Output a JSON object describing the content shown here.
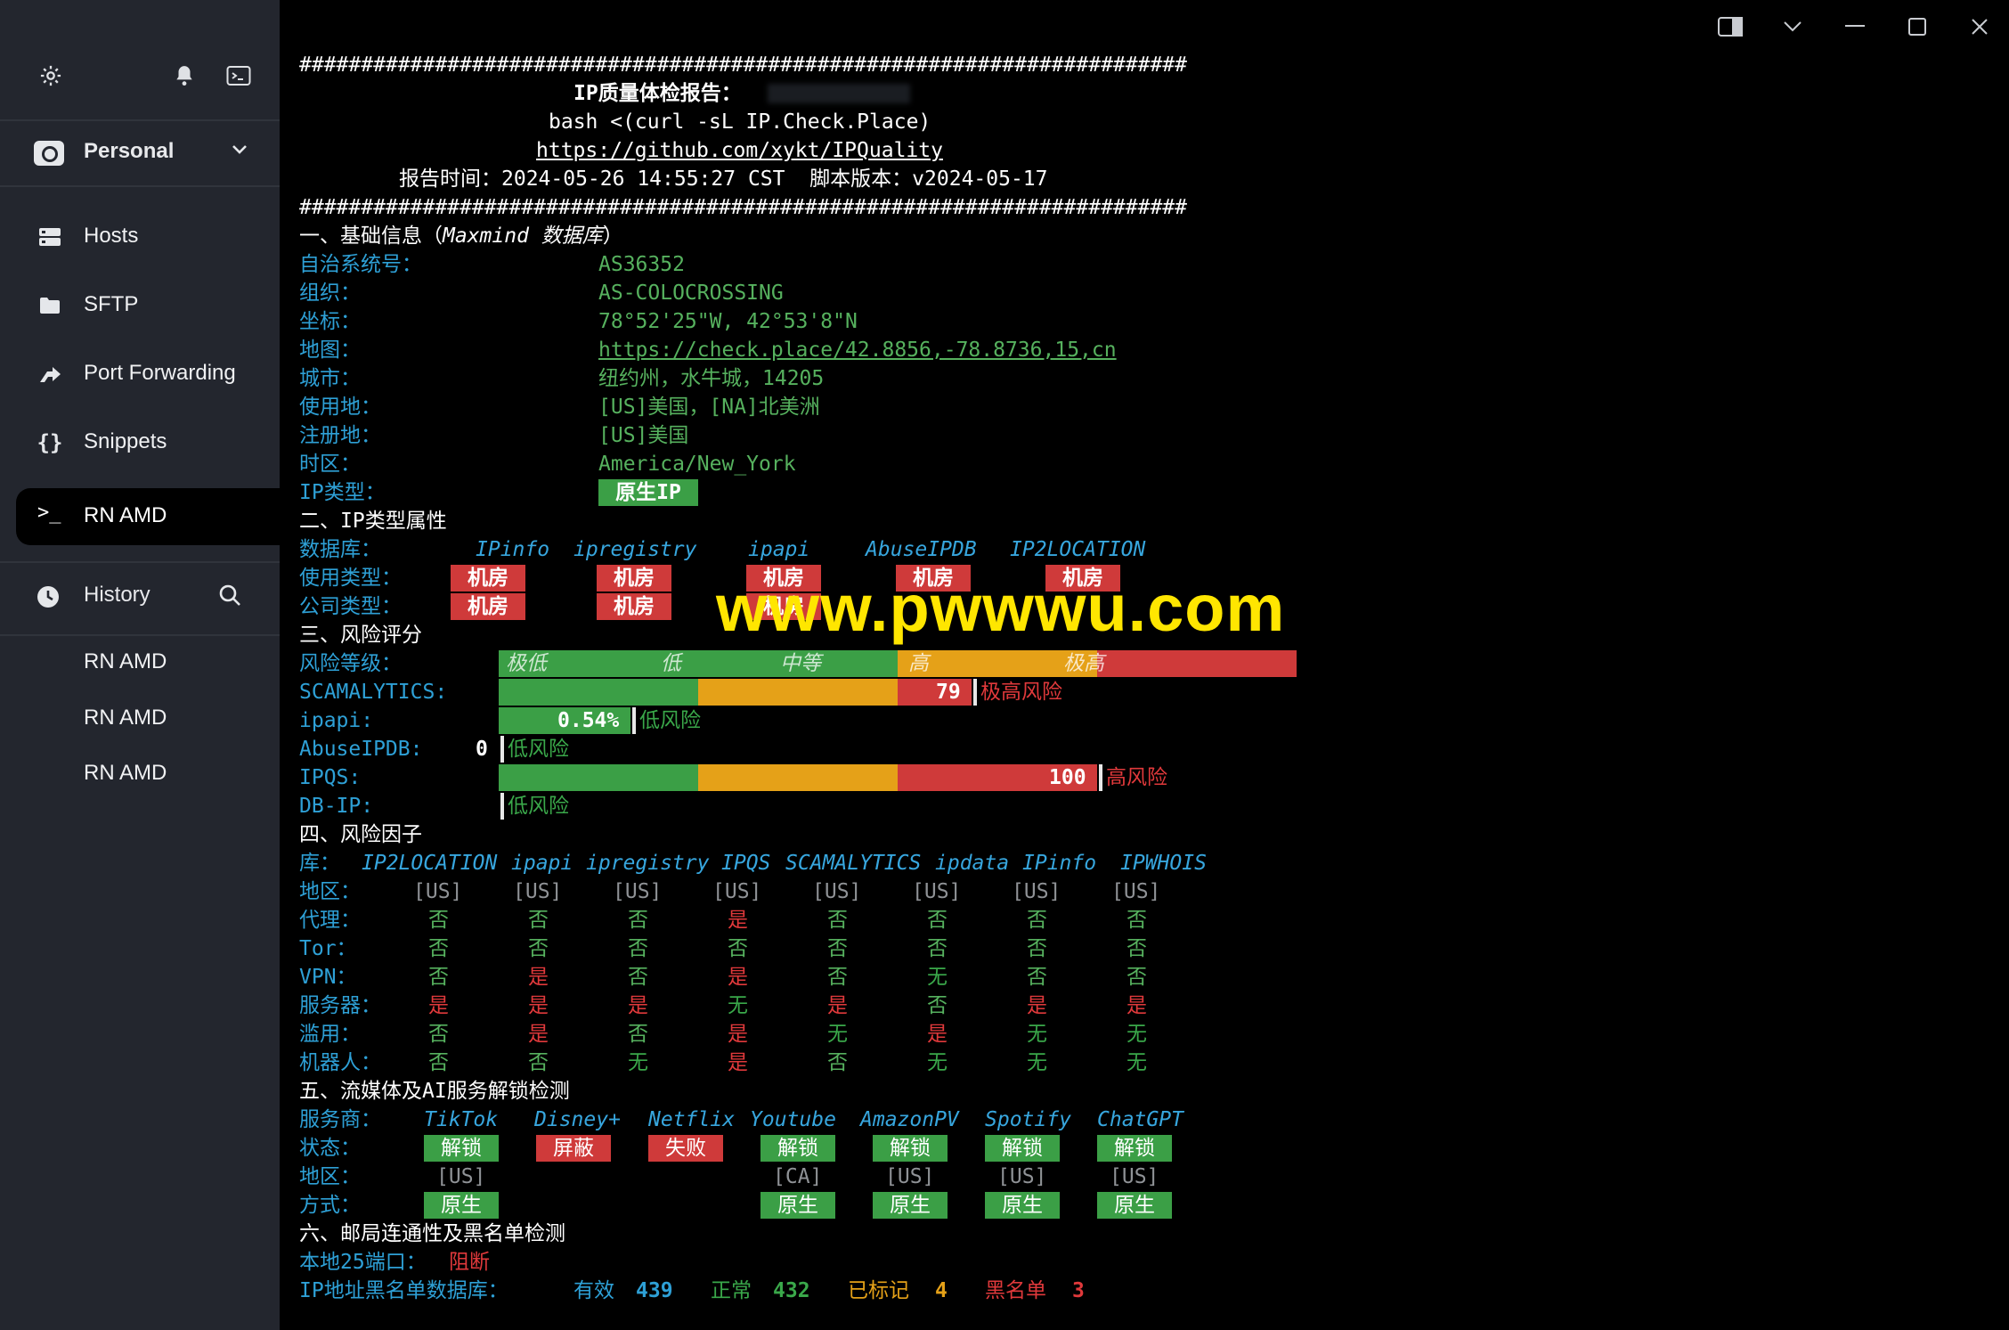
{
  "sidebar": {
    "vault_label": "Personal",
    "nav": [
      {
        "label": "Hosts",
        "icon": "hosts-icon"
      },
      {
        "label": "SFTP",
        "icon": "folder-icon"
      },
      {
        "label": "Port Forwarding",
        "icon": "port-forwarding-icon"
      },
      {
        "label": "Snippets",
        "icon": "braces-icon"
      }
    ],
    "active_tab": "RN AMD",
    "history_label": "History",
    "history_items": [
      "RN AMD",
      "RN AMD",
      "RN AMD"
    ]
  },
  "terminal": {
    "hash_line": "########################################################################",
    "title": "IP质量体检报告：",
    "cmd": "bash <(curl -sL IP.Check.Place)",
    "url": "https://github.com/xykt/IPQuality",
    "time_label": "报告时间：2024-05-26 14:55:27 CST  脚本版本：v2024-05-17",
    "s1": {
      "heading": "一、基础信息（",
      "heading_db": "Maxmind 数据库",
      "heading_end": "）",
      "rows": [
        {
          "k": "自治系统号：",
          "v": "AS36352"
        },
        {
          "k": "组织：",
          "v": "AS-COLOCROSSING"
        },
        {
          "k": "坐标：",
          "v": "78°52'25\"W, 42°53'8\"N"
        },
        {
          "k": "地图：",
          "v": "https://check.place/42.8856,-78.8736,15,cn"
        },
        {
          "k": "城市：",
          "v": "纽约州，水牛城，14205"
        },
        {
          "k": "使用地：",
          "v": "[US]美国，[NA]北美洲"
        },
        {
          "k": "注册地：",
          "v": "[US]美国"
        },
        {
          "k": "时区：",
          "v": "America/New_York"
        }
      ],
      "iptype_label": "IP类型：",
      "iptype_badge": "原生IP"
    },
    "s2": {
      "heading": "二、IP类型属性",
      "db_label": "数据库：",
      "dbs": [
        "IPinfo",
        "ipregistry",
        "ipapi",
        "AbuseIPDB",
        "IP2LOCATION"
      ],
      "use_label": "使用类型：",
      "use_vals": [
        "机房",
        "机房",
        "机房",
        "机房",
        "机房"
      ],
      "corp_label": "公司类型：",
      "corp_vals": [
        "机房",
        "机房",
        "机房"
      ]
    },
    "s3": {
      "heading": "三、风险评分",
      "level_label": "风险等级：",
      "levels": [
        "极低",
        "低",
        "中等",
        "高",
        "极高"
      ],
      "rows": [
        {
          "k": "SCAMALYTICS:",
          "score": "79",
          "text": "极高风险",
          "fraction": 0.79
        },
        {
          "k": "ipapi:",
          "score": "0.54%",
          "text": "低风险",
          "fraction": 0.22
        },
        {
          "k": "AbuseIPDB:",
          "score": "0",
          "text": "低风险",
          "fraction": 0.0
        },
        {
          "k": "IPQS:",
          "score": "100",
          "text": "高风险",
          "fraction": 1.0
        },
        {
          "k": "DB-IP:",
          "score": "",
          "text": "低风险",
          "fraction": 0.0
        }
      ]
    },
    "s4": {
      "heading": "四、风险因子",
      "lib_label": "库：",
      "libs": [
        "IP2LOCATION",
        "ipapi",
        "ipregistry",
        "IPQS",
        "SCAMALYTICS",
        "ipdata",
        "IPinfo",
        "IPWHOIS"
      ],
      "rows": [
        {
          "k": "地区：",
          "vals": [
            "[US]",
            "[US]",
            "[US]",
            "[US]",
            "[US]",
            "[US]",
            "[US]",
            "[US]"
          ]
        },
        {
          "k": "代理：",
          "vals": [
            "否",
            "否",
            "否",
            "是",
            "否",
            "否",
            "否",
            "否"
          ]
        },
        {
          "k": "Tor：",
          "vals": [
            "否",
            "否",
            "否",
            "否",
            "否",
            "否",
            "否",
            "否"
          ]
        },
        {
          "k": "VPN：",
          "vals": [
            "否",
            "是",
            "否",
            "是",
            "否",
            "无",
            "否",
            "否"
          ]
        },
        {
          "k": "服务器：",
          "vals": [
            "是",
            "是",
            "是",
            "无",
            "是",
            "否",
            "是",
            "是"
          ]
        },
        {
          "k": "滥用：",
          "vals": [
            "否",
            "是",
            "否",
            "是",
            "无",
            "是",
            "无",
            "无"
          ]
        },
        {
          "k": "机器人：",
          "vals": [
            "否",
            "否",
            "无",
            "是",
            "否",
            "无",
            "无",
            "无"
          ]
        }
      ]
    },
    "s5": {
      "heading": "五、流媒体及AI服务解锁检测",
      "svc_label": "服务商：",
      "services": [
        "TikTok",
        "Disney+",
        "Netflix",
        "Youtube",
        "AmazonPV",
        "Spotify",
        "ChatGPT"
      ],
      "status_label": "状态：",
      "status": [
        "解锁",
        "屏蔽",
        "失败",
        "解锁",
        "解锁",
        "解锁",
        "解锁"
      ],
      "region_label": "地区：",
      "regions": [
        "[US]",
        "",
        "",
        "[CA]",
        "[US]",
        "[US]",
        "[US]"
      ],
      "method_label": "方式：",
      "methods": [
        "原生",
        "",
        "",
        "原生",
        "原生",
        "原生",
        "原生"
      ]
    },
    "s6": {
      "heading": "六、邮局连通性及黑名单检测",
      "port_label": "本地25端口：",
      "port_value": "阻断",
      "bl_label": "IP地址黑名单数据库：",
      "valid_label": "有效",
      "valid_value": "439",
      "normal_label": "正常",
      "normal_value": "432",
      "marked_label": "已标记",
      "marked_value": "4",
      "black_label": "黑名单",
      "black_value": "3"
    }
  },
  "watermark": "www.pwwwu.com",
  "colors": {
    "sidebar_bg": "#23262e",
    "terminal_bg": "#000000",
    "cyan": "#2ea0d6",
    "green": "#3aa84a",
    "red": "#e0393b",
    "orange": "#e5a118",
    "watermark": "#ffe600"
  }
}
